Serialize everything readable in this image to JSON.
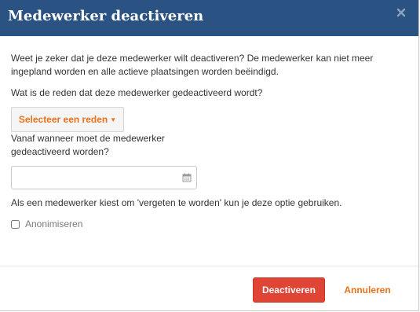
{
  "dialog": {
    "title": "Medewerker deactiveren",
    "close_icon": "close-icon"
  },
  "body": {
    "warning_text": "Weet je zeker dat je deze medewerker wilt deactiveren? De medewerker kan niet meer ingepland worden en alle actieve plaatsingen worden beëindigd.",
    "reason_question": "Wat is de reden dat deze medewerker gedeactiveerd wordt?",
    "reason_button_label": "Selecteer een reden",
    "reason_caret_icon": "caret-down-icon",
    "date_label": "Vanaf wanneer moet de medewerker gedeactiveerd worden?",
    "date_value": "",
    "date_placeholder": "",
    "calendar_icon": "calendar-icon",
    "forget_text": "Als een medewerker kiest om 'vergeten te worden' kun je deze optie gebruiken.",
    "anonymize_label": "Anonimiseren",
    "anonymize_checked": false
  },
  "footer": {
    "deactivate_label": "Deactiveren",
    "cancel_label": "Annuleren"
  },
  "colors": {
    "header_bg": "#2a5283",
    "accent_orange": "#e8711a",
    "danger_red": "#e04434"
  }
}
